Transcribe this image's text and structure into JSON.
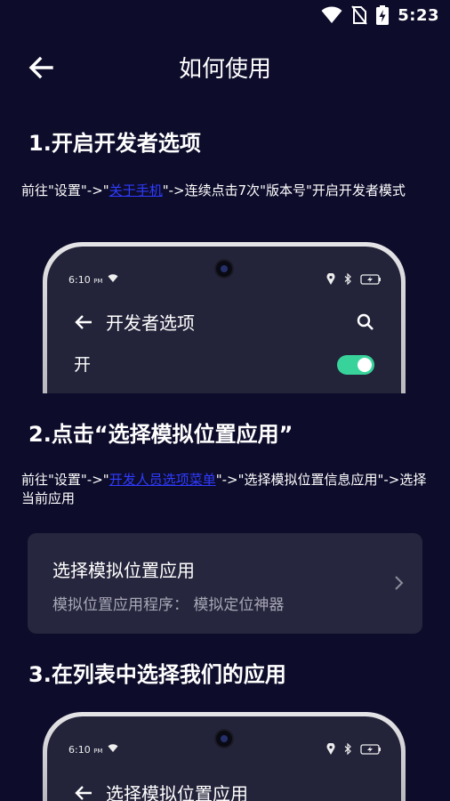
{
  "status_bar": {
    "time": "5:23"
  },
  "header": {
    "title": "如何使用"
  },
  "steps": [
    {
      "heading": "1.开启开发者选项",
      "desc_prefix": "前往\"设置\"->\"",
      "desc_link": "关于手机",
      "desc_suffix": "\"->连续点击7次\"版本号\"开启开发者模式",
      "phone": {
        "time": "6:10",
        "ampm": "PM",
        "screen_title": "开发者选项",
        "toggle_label": "开",
        "toggle_on": true
      }
    },
    {
      "heading": "2.点击“选择模拟位置应用”",
      "desc_prefix": "前往\"设置\"->\"",
      "desc_link": "开发人员选项菜单",
      "desc_suffix": "\"->\"选择模拟位置信息应用\"->选择当前应用",
      "card": {
        "title": "选择模拟位置应用",
        "subtitle": "模拟位置应用程序：  模拟定位神器"
      }
    },
    {
      "heading": "3.在列表中选择我们的应用",
      "phone": {
        "time": "6:10",
        "ampm": "PM",
        "screen_title": "选择模拟位置应用"
      }
    }
  ],
  "colors": {
    "background": "#0d0c2b",
    "link": "#2f3cff",
    "toggle": "#37d39a",
    "card": "#26263e"
  }
}
